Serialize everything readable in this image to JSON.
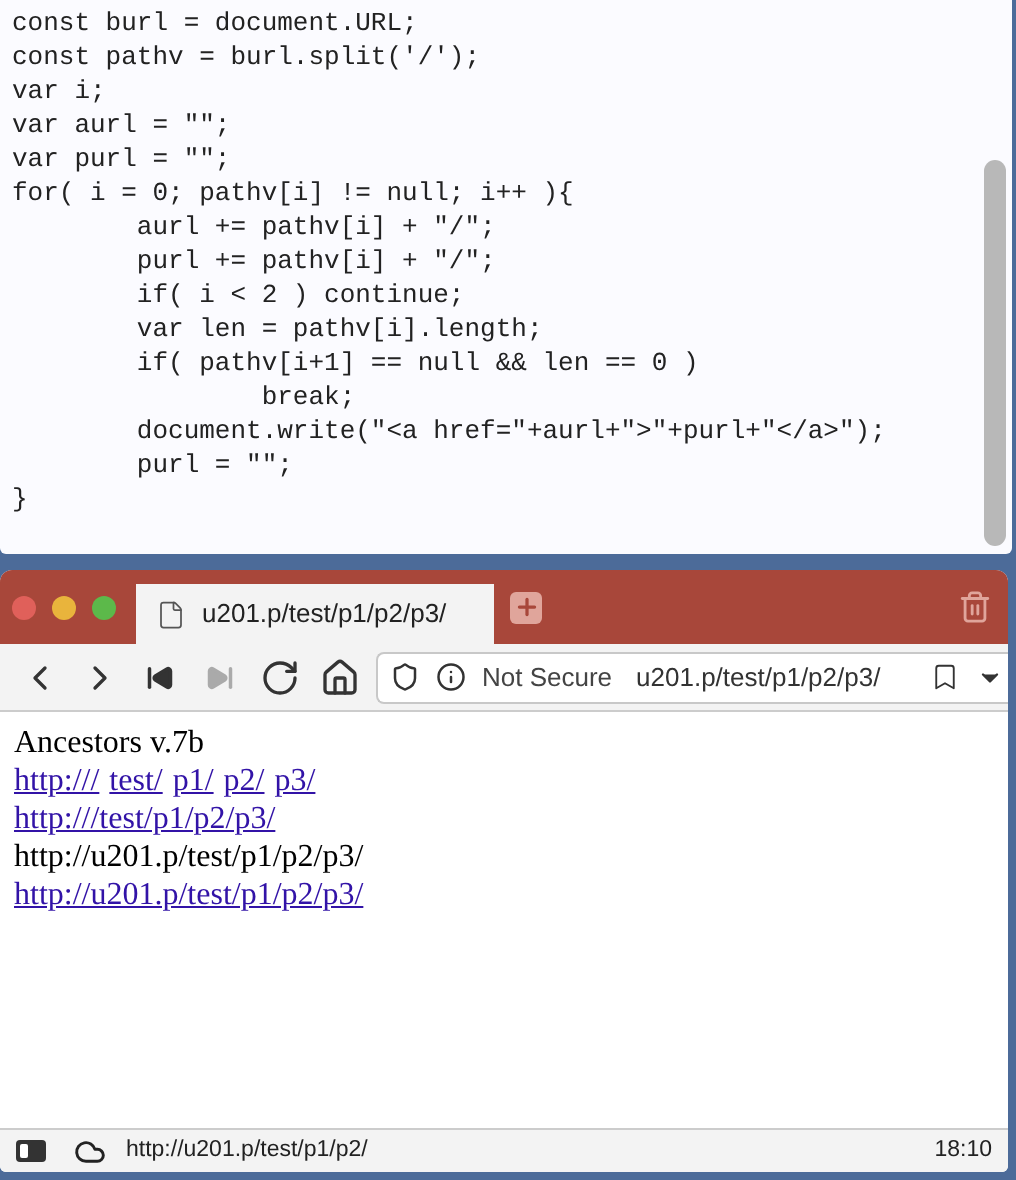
{
  "editor": {
    "code_lines": [
      "const burl = document.URL;",
      "const pathv = burl.split('/');",
      "var i;",
      "var aurl = \"\";",
      "var purl = \"\";",
      "for( i = 0; pathv[i] != null; i++ ){",
      "        aurl += pathv[i] + \"/\";",
      "        purl += pathv[i] + \"/\";",
      "        if( i < 2 ) continue;",
      "        var len = pathv[i].length;",
      "        if( pathv[i+1] == null && len == 0 )",
      "                break;",
      "        document.write(\"<a href=\"+aurl+\">\"+purl+\"</a>\");",
      "        purl = \"\";",
      "}"
    ]
  },
  "browser": {
    "tabs": [
      {
        "title": "u201.p/test/p1/p2/p3/",
        "selected": true
      }
    ],
    "nav_buttons": [
      {
        "kind": "back",
        "disabled": false
      },
      {
        "kind": "forward",
        "disabled": false
      },
      {
        "kind": "first",
        "disabled": false
      },
      {
        "kind": "last",
        "disabled": true
      },
      {
        "kind": "reload",
        "disabled": false
      },
      {
        "kind": "home",
        "disabled": false
      }
    ],
    "address_bar": {
      "security": "Not Secure",
      "url": "u201.p/test/p1/p2/p3/"
    },
    "page": {
      "lines": [
        {
          "parts": [
            {
              "text": "Ancestors v.7b",
              "link": false
            }
          ]
        },
        {
          "parts": [
            {
              "text": "http:///",
              "link": true
            },
            {
              "text": "test/",
              "link": true
            },
            {
              "text": "p1/",
              "link": true
            },
            {
              "text": "p2/",
              "link": true
            },
            {
              "text": "p3/",
              "link": true
            }
          ]
        },
        {
          "parts": [
            {
              "text": "http:///test/p1/p2/p3/",
              "link": true
            }
          ]
        },
        {
          "parts": [
            {
              "text": "http://u201.p/test/p1/p2/p3/",
              "link": false
            }
          ]
        },
        {
          "parts": [
            {
              "text": "http://u201.p/test/p1/p2/p3/",
              "link": true
            }
          ]
        }
      ]
    },
    "status_bar": {
      "url": "http://u201.p/test/p1/p2/",
      "time": "18:10"
    }
  }
}
